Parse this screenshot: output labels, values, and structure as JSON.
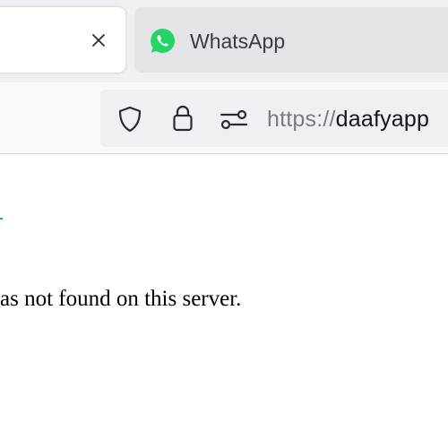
{
  "tabs": {
    "active": {
      "title": "",
      "close_icon": "close-icon"
    },
    "inactive": {
      "title": "WhatsApp",
      "icon": "whatsapp-icon"
    }
  },
  "navbar": {
    "url_scheme": "https://",
    "url_host": "daafyapp",
    "icons": [
      "shield-icon",
      "lock-icon",
      "permissions-icon"
    ]
  },
  "page": {
    "message": "as not found on this server."
  },
  "colors": {
    "whatsapp_green": "#25d366",
    "link_blue": "#0ea5e9",
    "tabbar_bg": "#f0f0f4",
    "urlbar_bg": "#f0f0f4"
  }
}
